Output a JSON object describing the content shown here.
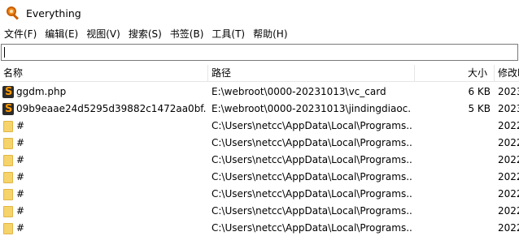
{
  "window": {
    "title": "Everything",
    "app_icon": "magnifier-icon"
  },
  "menu": [
    "文件(F)",
    "编辑(E)",
    "视图(V)",
    "搜索(S)",
    "书签(B)",
    "工具(T)",
    "帮助(H)"
  ],
  "search": {
    "value": ""
  },
  "columns": {
    "name": "名称",
    "path": "路径",
    "size": "大小",
    "modified": "修改时"
  },
  "rows": [
    {
      "icon": "php-file-icon",
      "name": "ggdm.php",
      "path": "E:\\webroot\\0000-20231013\\vc_card",
      "size": "6 KB",
      "modified": "2023"
    },
    {
      "icon": "php-file-icon",
      "name": "09b9eaae24d5295d39882c1472aa0bf...",
      "path": "E:\\webroot\\0000-20231013\\jindingdiaoc...",
      "size": "5 KB",
      "modified": "2023"
    },
    {
      "icon": "folder-icon",
      "name": "#",
      "path": "C:\\Users\\netcc\\AppData\\Local\\Programs...",
      "size": "",
      "modified": "2022"
    },
    {
      "icon": "folder-icon",
      "name": "#",
      "path": "C:\\Users\\netcc\\AppData\\Local\\Programs...",
      "size": "",
      "modified": "2022"
    },
    {
      "icon": "folder-icon",
      "name": "#",
      "path": "C:\\Users\\netcc\\AppData\\Local\\Programs...",
      "size": "",
      "modified": "2022"
    },
    {
      "icon": "folder-icon",
      "name": "#",
      "path": "C:\\Users\\netcc\\AppData\\Local\\Programs...",
      "size": "",
      "modified": "2022"
    },
    {
      "icon": "folder-icon",
      "name": "#",
      "path": "C:\\Users\\netcc\\AppData\\Local\\Programs...",
      "size": "",
      "modified": "2022"
    },
    {
      "icon": "folder-icon",
      "name": "#",
      "path": "C:\\Users\\netcc\\AppData\\Local\\Programs...",
      "size": "",
      "modified": "2022"
    },
    {
      "icon": "folder-icon",
      "name": "#",
      "path": "C:\\Users\\netcc\\AppData\\Local\\Programs...",
      "size": "",
      "modified": "2022"
    }
  ]
}
